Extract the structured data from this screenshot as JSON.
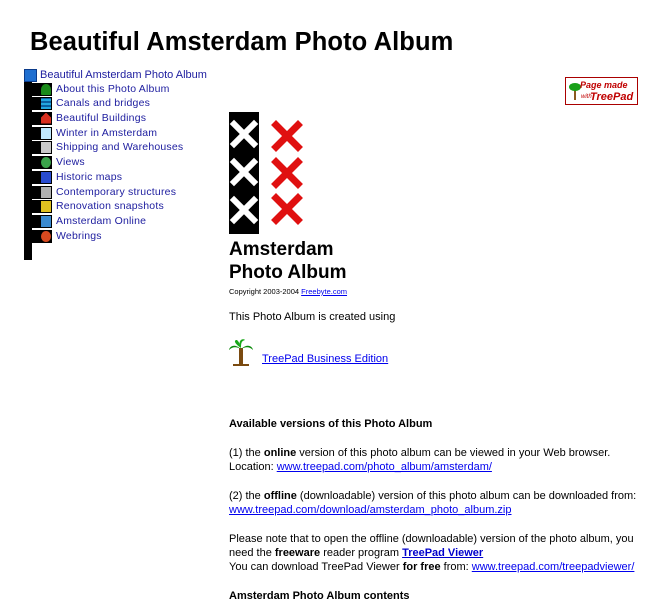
{
  "page": {
    "title": "Beautiful Amsterdam Photo Album"
  },
  "tree": {
    "root": "Beautiful Amsterdam Photo Album",
    "items": [
      {
        "label": "About this Photo Album",
        "icon": "palm-tree-icon"
      },
      {
        "label": "Canals and bridges",
        "icon": "water-icon"
      },
      {
        "label": "Beautiful Buildings",
        "icon": "house-icon"
      },
      {
        "label": "Winter in Amsterdam",
        "icon": "snowflake-icon"
      },
      {
        "label": "Shipping and Warehouses",
        "icon": "warehouse-icon"
      },
      {
        "label": "Views",
        "icon": "globe-icon"
      },
      {
        "label": "Historic maps",
        "icon": "map-icon"
      },
      {
        "label": "Contemporary structures",
        "icon": "building-icon"
      },
      {
        "label": "Renovation snapshots",
        "icon": "crane-icon"
      },
      {
        "label": "Amsterdam Online",
        "icon": "network-icon"
      },
      {
        "label": "Webrings",
        "icon": "webring-icon"
      }
    ]
  },
  "badge": {
    "line1": "Page made",
    "line0": "with",
    "line2": "TreePad"
  },
  "content": {
    "logo_title_1": "Amsterdam",
    "logo_title_2": "Photo Album",
    "copyright_text": "Copyright 2003-2004",
    "copyright_link": "Freebyte.com",
    "created_using": "This Photo Album is created using",
    "treepad_link": "TreePad Business Edition",
    "versions_heading": "Available versions of this Photo Album",
    "online_prefix": "(1) the ",
    "online_bold": "online",
    "online_suffix": " version of this photo album can be viewed in your Web browser.",
    "location_label": "Location: ",
    "location_url": "www.treepad.com/photo_album/amsterdam/",
    "offline_prefix": "(2) the ",
    "offline_bold": "offline",
    "offline_suffix": " (downloadable) version of this photo album can be downloaded from:",
    "offline_url": "www.treepad.com/download/amsterdam_photo_album.zip",
    "note_line1": "Please note that to open the offline (downloadable) version of the photo album, you",
    "note_line2_prefix": "need the ",
    "note_line2_bold": "freeware",
    "note_line2_mid": " reader program ",
    "viewer_link": "TreePad Viewer",
    "note_line3_prefix": "You can download TreePad Viewer ",
    "note_line3_bold": "for free",
    "note_line3_mid": " from: ",
    "viewer_url": "www.treepad.com/treepadviewer/",
    "contents_heading": "Amsterdam Photo Album contents"
  },
  "colors": {
    "link": "#0000ee",
    "tree_link": "#2020a0",
    "x_red": "#e01010",
    "badge_red": "#c00000"
  }
}
